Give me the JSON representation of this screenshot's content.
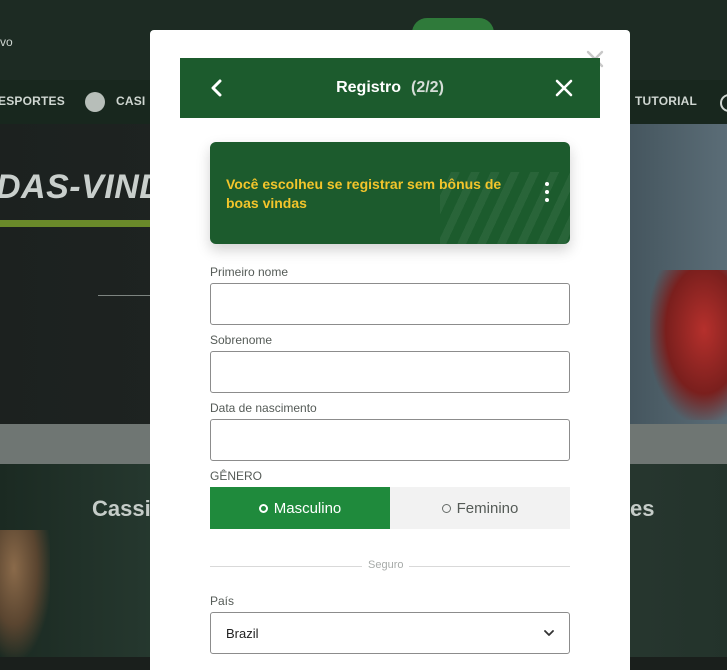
{
  "background": {
    "top_text": "vo",
    "nav_items": [
      "ESPORTES",
      "CASI",
      "TUTORIAL"
    ],
    "hero_title": "DAS-VINDA",
    "section_left": "Cassi",
    "section_right": "es"
  },
  "modal": {
    "title": "Registro",
    "step": "(2/2)",
    "bonus_message": "Você escolheu se registrar sem bônus de boas vindas",
    "fields": {
      "first_name": {
        "label": "Primeiro nome",
        "value": ""
      },
      "last_name": {
        "label": "Sobrenome",
        "value": ""
      },
      "birth_date": {
        "label": "Data de nascimento",
        "value": ""
      }
    },
    "gender": {
      "label": "GÊNERO",
      "options": [
        "Masculino",
        "Feminino"
      ],
      "selected": "Masculino"
    },
    "divider_label": "Seguro",
    "country": {
      "label": "País",
      "value": "Brazil"
    }
  },
  "colors": {
    "header_green": "#1c5b2d",
    "active_green": "#1f8a3c",
    "bonus_yellow": "#f3c52b"
  },
  "icons": {
    "back": "chevron-left-icon",
    "close": "close-icon",
    "menu": "kebab-menu-icon",
    "select": "chevron-down-icon"
  }
}
